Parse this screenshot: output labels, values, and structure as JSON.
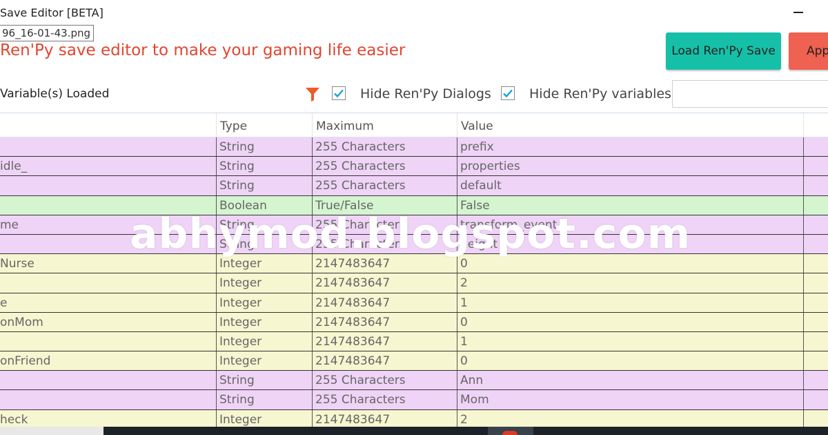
{
  "window": {
    "title": "Save Editor [BETA]",
    "tooltip": "96_16-01-43.png"
  },
  "header": {
    "subtitle": "Ren'Py save editor to make your gaming life easier",
    "load_button": "Load Ren'Py Save",
    "apply_button": "Apply"
  },
  "toolbar": {
    "status": "Variable(s) Loaded",
    "hide_dialogs_label": "Hide Ren'Py Dialogs",
    "hide_dialogs_checked": true,
    "hide_variables_label": "Hide Ren'Py variables",
    "hide_variables_checked": true,
    "search_value": ""
  },
  "grid": {
    "columns": [
      "",
      "Type",
      "Maximum",
      "Value",
      ""
    ],
    "rows": [
      {
        "name": "",
        "type": "String",
        "max": "255 Characters",
        "value": "prefix",
        "color": "#efd4f7"
      },
      {
        "name": "idle_",
        "type": "String",
        "max": "255 Characters",
        "value": "properties",
        "color": "#efd4f7"
      },
      {
        "name": "",
        "type": "String",
        "max": "255 Characters",
        "value": "default",
        "color": "#efd4f7"
      },
      {
        "name": "",
        "type": "Boolean",
        "max": "True/False",
        "value": "False",
        "color": "#d4f5cf"
      },
      {
        "name": "me",
        "type": "String",
        "max": "255 Characters",
        "value": "transform_event",
        "color": "#efd4f7"
      },
      {
        "name": "",
        "type": "String",
        "max": "255 Characters",
        "value": "height",
        "color": "#efd4f7"
      },
      {
        "name": "Nurse",
        "type": "Integer",
        "max": "2147483647",
        "value": "0",
        "color": "#f6f6d0"
      },
      {
        "name": "",
        "type": "Integer",
        "max": "2147483647",
        "value": "2",
        "color": "#f6f6d0"
      },
      {
        "name": "e",
        "type": "Integer",
        "max": "2147483647",
        "value": "1",
        "color": "#f6f6d0"
      },
      {
        "name": "onMom",
        "type": "Integer",
        "max": "2147483647",
        "value": "0",
        "color": "#f6f6d0"
      },
      {
        "name": "",
        "type": "Integer",
        "max": "2147483647",
        "value": "1",
        "color": "#f6f6d0"
      },
      {
        "name": "onFriend",
        "type": "Integer",
        "max": "2147483647",
        "value": "0",
        "color": "#f6f6d0"
      },
      {
        "name": "",
        "type": "String",
        "max": "255 Characters",
        "value": "Ann",
        "color": "#efd4f7"
      },
      {
        "name": "",
        "type": "String",
        "max": "255 Characters",
        "value": "Mom",
        "color": "#efd4f7"
      },
      {
        "name": "heck",
        "type": "Integer",
        "max": "2147483647",
        "value": "2",
        "color": "#f6f6d0"
      }
    ]
  },
  "watermark": "abhymod.blogspot.com",
  "colors": {
    "accent_red": "#e04530",
    "load_button": "#16c0a8",
    "apply_button": "#ef6150",
    "checkbox_tick": "#1a9fd9",
    "filter_icon": "#f05a28"
  },
  "icons": {
    "filter": "filter-funnel-icon",
    "check": "check-icon",
    "minimize": "minimize-icon"
  }
}
